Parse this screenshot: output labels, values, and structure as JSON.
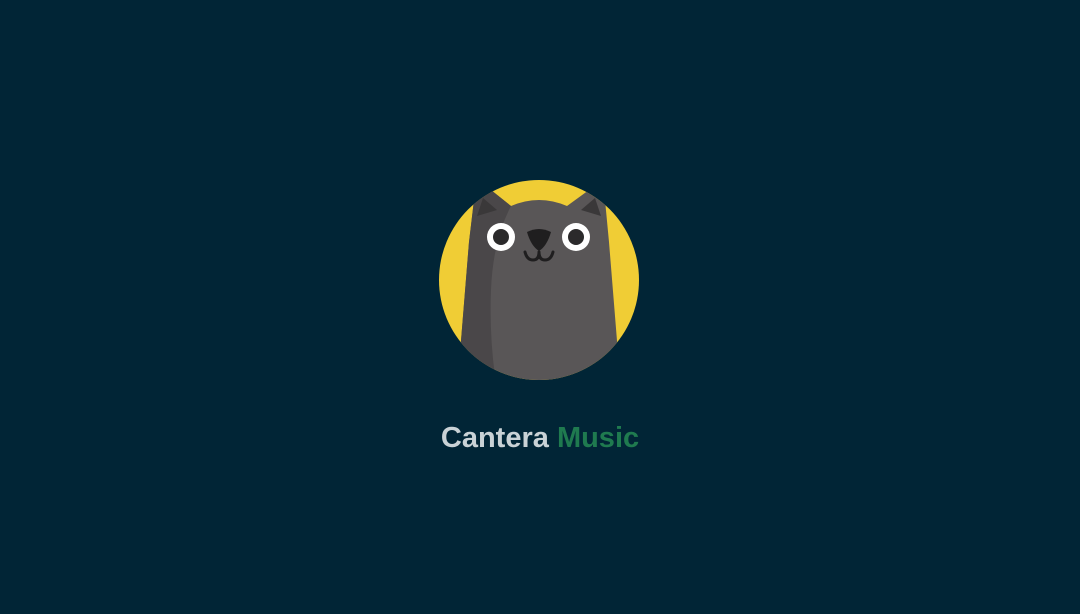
{
  "splash": {
    "logo_icon": "cat-face-icon",
    "app_name_first": "Cantera",
    "app_name_second": "Music"
  },
  "colors": {
    "background": "#012536",
    "logo_circle": "#f0cd35",
    "cat_body": "#595657",
    "cat_shadow": "#4a4749",
    "app_name_first": "#c9d2d6",
    "app_name_accent": "#1f7a4f"
  }
}
